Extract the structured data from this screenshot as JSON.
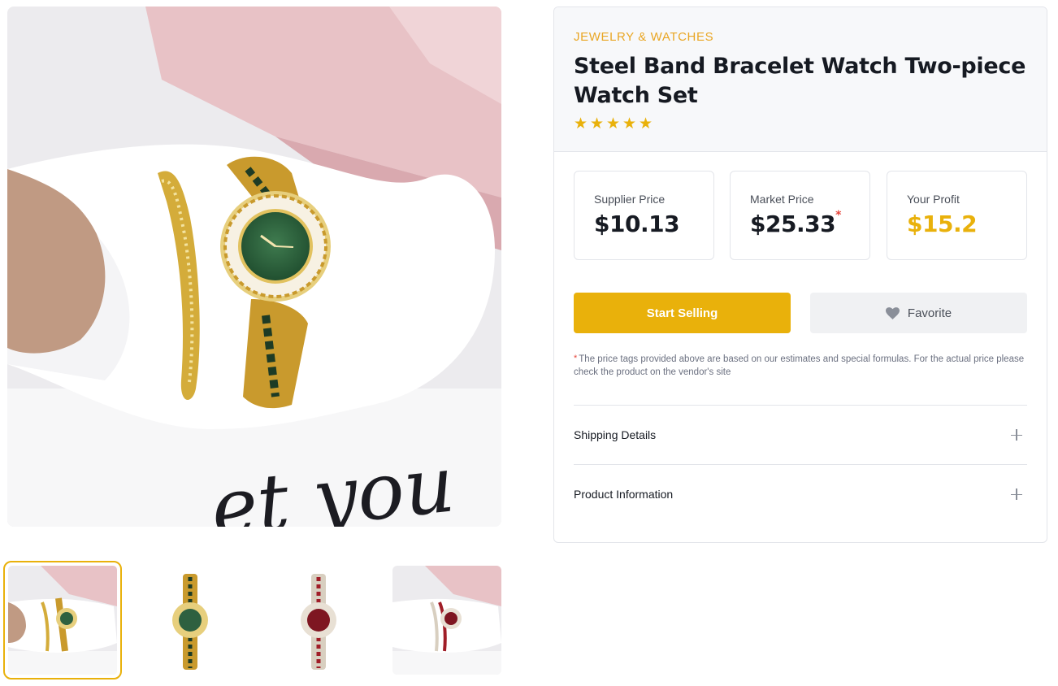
{
  "gallery": {
    "main_image_icon": "wrist-bracelet-watch-photo",
    "thumbnails": [
      {
        "icon": "wrist-bracelet-watch-photo",
        "active": true
      },
      {
        "icon": "green-watch-photo",
        "active": false
      },
      {
        "icon": "red-watch-photo",
        "active": false
      },
      {
        "icon": "wrist-red-watch-photo",
        "active": false
      }
    ],
    "photo_script_text": "et you"
  },
  "product": {
    "category": "JEWELRY & WATCHES",
    "title": "Steel Band Bracelet Watch Two-piece Watch Set",
    "rating_stars": 5
  },
  "prices": {
    "supplier": {
      "label": "Supplier Price",
      "value": "$10.13"
    },
    "market": {
      "label": "Market Price",
      "value": "$25.33",
      "marker": "*"
    },
    "profit": {
      "label": "Your Profit",
      "value": "$15.2"
    }
  },
  "actions": {
    "start_selling": "Start Selling",
    "favorite": "Favorite",
    "favorite_icon": "heart-icon"
  },
  "disclaimer": {
    "marker": "*",
    "text": "The price tags provided above are based on our estimates and special formulas. For the actual price please check the product on the vendor's site"
  },
  "accordion": [
    {
      "label": "Shipping Details",
      "icon": "plus-icon"
    },
    {
      "label": "Product Information",
      "icon": "plus-icon"
    }
  ],
  "colors": {
    "accent": "#e9b10b",
    "category": "#e9a623",
    "asterisk": "#e5443a"
  }
}
